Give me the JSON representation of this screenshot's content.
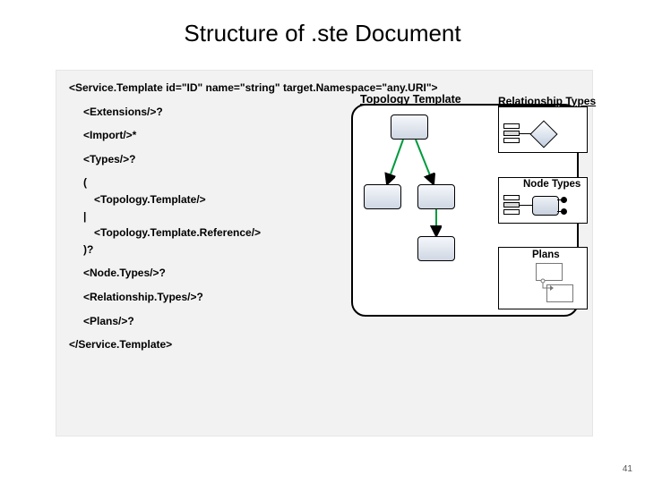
{
  "title": "Structure of .ste Document",
  "code": {
    "open": "<Service.Template id=\"ID\" name=\"string\" target.Namespace=\"any.URI\">",
    "extensions": "<Extensions/>?",
    "import": "<Import/>*",
    "types": "<Types/>?",
    "group_open": "(",
    "topology": "<Topology.Template/>",
    "pipe": "|",
    "topology_ref": "<Topology.Template.Reference/>",
    "group_close": ")?",
    "node_types": "<Node.Types/>?",
    "rel_types": "<Relationship.Types/>?",
    "plans": "<Plans/>?",
    "close": "</Service.Template>"
  },
  "diagram": {
    "topology_label": "Topology Template",
    "relationship_label": "Relationship Types",
    "node_label": "Node Types",
    "plans_label": "Plans"
  },
  "page_number": "41"
}
